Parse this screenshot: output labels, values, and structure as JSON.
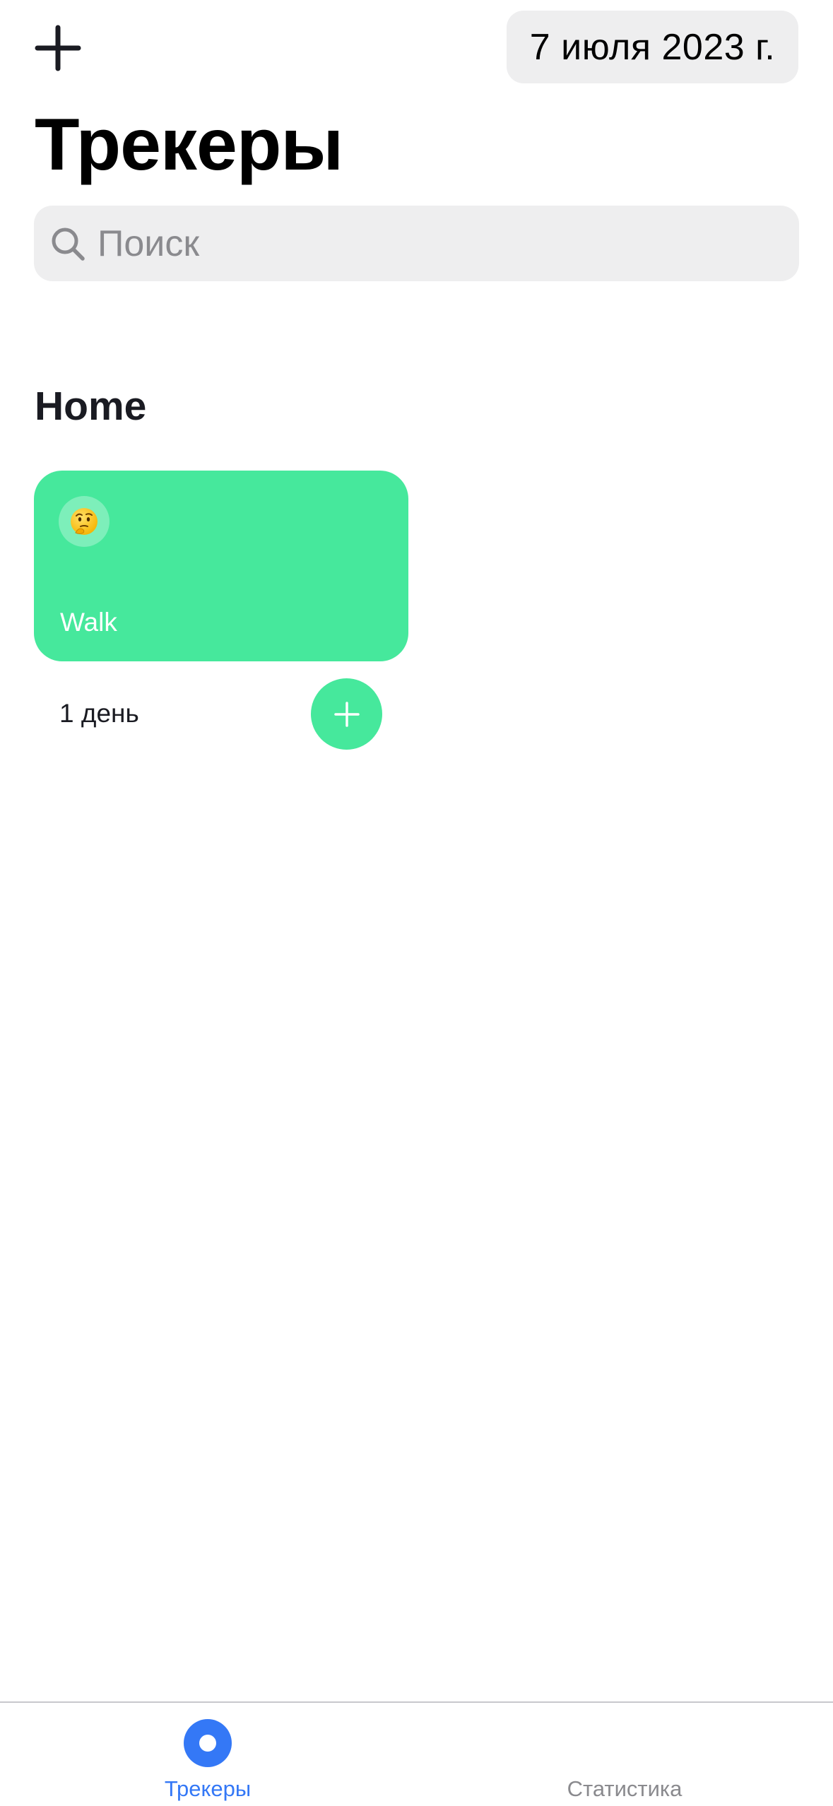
{
  "nav": {
    "add_icon": "plus-icon",
    "date_label": "7 июля 2023 г."
  },
  "header": {
    "title": "Трекеры"
  },
  "search": {
    "icon": "search-icon",
    "placeholder": "Поиск",
    "value": ""
  },
  "categories": [
    {
      "title": "Home",
      "trackers": [
        {
          "emoji": "🤔",
          "name": "Walk",
          "color": "#46e89c",
          "days_label": "1 день",
          "action_icon": "plus-icon"
        }
      ]
    }
  ],
  "tabbar": {
    "tabs": [
      {
        "label": "Трекеры",
        "icon": "tracker-ring-icon",
        "active": true,
        "color": "#3478f6"
      },
      {
        "label": "Статистика",
        "icon": "stats-icon",
        "active": false,
        "color": "#8a8a8e"
      }
    ]
  }
}
